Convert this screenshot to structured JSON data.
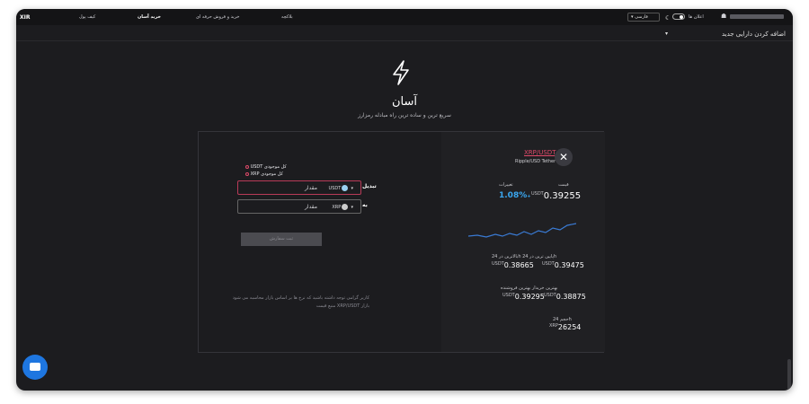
{
  "header": {
    "logo": "XIR",
    "nav": [
      "کیف پول",
      "خرید آسان",
      "خرید و فروش حرفه ای",
      "بلاکچه"
    ],
    "language": "فارسی",
    "announcements": "اعلان ها"
  },
  "subbar": {
    "add_asset": "اضافه کردن دارایی جدید"
  },
  "hero": {
    "title": "آسان",
    "subtitle": "سریع ترین و ساده ترین راه مبادله رمزارز"
  },
  "market": {
    "pair": "XRP/USDT",
    "pair_name": "Ripple/USD Tether",
    "price_label": "قیمت",
    "price_unit": "USDT",
    "price": "0.39255",
    "change_label": "تغییرات",
    "change": "1.08%",
    "change_sign": "+",
    "range_label": "بالاترین در 24h پایین ترین در 24h",
    "high_unit": "USDT",
    "high": "0.39475",
    "low_unit": "USDT",
    "low": "0.38665",
    "best_label": "بهترین خریدار بهترین فروشنده",
    "best_seller_unit": "USDT",
    "best_seller": "0.38875",
    "best_buyer_unit": "USDT",
    "best_buyer": "0.39295",
    "volume_label": "حجم 24h",
    "volume_unit": "XRP",
    "volume": "26254"
  },
  "form": {
    "option_1": "USDT کل موجودی",
    "option_2": "XRP کل موجودی",
    "convert_label": "تبدیل",
    "to_label": "به",
    "from_currency": "USDT",
    "to_currency": "XRP",
    "amount_placeholder": "مقدار",
    "submit_label": "ثبت سفارش",
    "note_line1": "کاربر گرامی توجه داشته باشید که نرخ ها بر اساس بازار محاسبه می شود",
    "note_line2": "منبع قیمت XRP/USDT بازار"
  }
}
